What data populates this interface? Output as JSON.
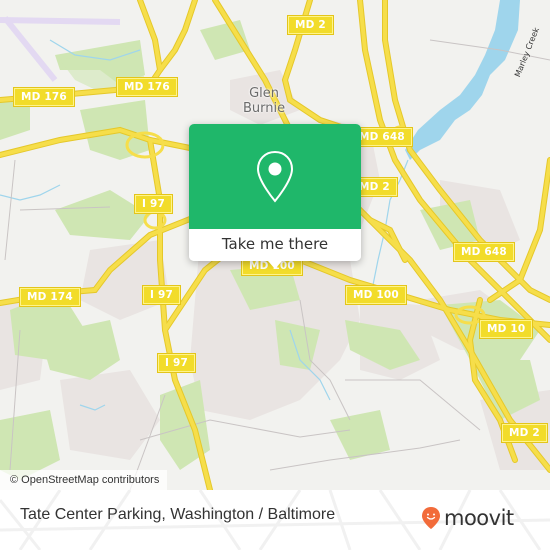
{
  "map": {
    "colors": {
      "background": "#f2f2ef",
      "park": "#cfe6b3",
      "urban": "#e8e2e0",
      "water": "#9fd5ec",
      "road": "#f6de4a",
      "road_edge": "#e5c82a",
      "accent": "#1fb76a"
    },
    "place_labels": [
      {
        "id": "glen-burnie",
        "text": "Glen\nBurnie"
      }
    ],
    "water_labels": [
      {
        "id": "marley-creek",
        "text": "Marley Creek"
      }
    ],
    "road_shields": [
      {
        "id": "md176-west",
        "text": "MD 176"
      },
      {
        "id": "md176-east",
        "text": "MD 176"
      },
      {
        "id": "md2-north",
        "text": "MD 2"
      },
      {
        "id": "md648-north",
        "text": "MD 648"
      },
      {
        "id": "i97-north",
        "text": "I 97"
      },
      {
        "id": "md2-mid",
        "text": "MD 2"
      },
      {
        "id": "md174",
        "text": "MD 174"
      },
      {
        "id": "i97-mid",
        "text": "I 97"
      },
      {
        "id": "md-hidden",
        "text": "MD 100"
      },
      {
        "id": "md100",
        "text": "MD 100"
      },
      {
        "id": "md648-south",
        "text": "MD 648"
      },
      {
        "id": "md10",
        "text": "MD 10"
      },
      {
        "id": "i97-south",
        "text": "I 97"
      },
      {
        "id": "md2-south",
        "text": "MD 2"
      }
    ],
    "attribution": "© OpenStreetMap contributors"
  },
  "popup": {
    "icon": "map-pin-icon",
    "button_label": "Take me there"
  },
  "footer": {
    "title": "Tate Center Parking, Washington / Baltimore",
    "brand": "moovit",
    "brand_icon": "moovit-smile-pin-icon",
    "brand_color": "#f26b3a"
  }
}
